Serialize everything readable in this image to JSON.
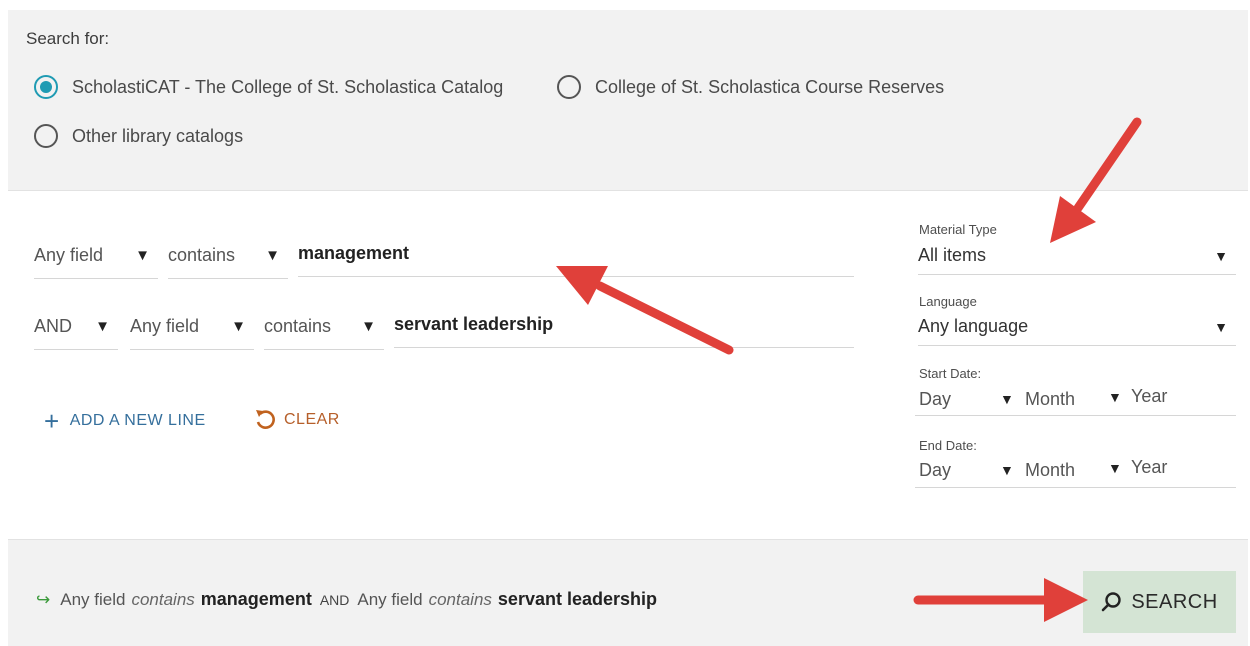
{
  "scope": {
    "title": "Search for:",
    "options": [
      {
        "label": "ScholastiCAT - The College of St. Scholastica Catalog",
        "selected": true
      },
      {
        "label": "College of St. Scholastica Course Reserves",
        "selected": false
      },
      {
        "label": "Other library catalogs",
        "selected": false
      }
    ]
  },
  "query": {
    "rows": [
      {
        "field": "Any field",
        "operator": "contains",
        "value": "management"
      },
      {
        "boolean": "AND",
        "field": "Any field",
        "operator": "contains",
        "value": "servant leadership"
      }
    ],
    "add_line_label": "ADD A NEW LINE",
    "clear_label": "CLEAR"
  },
  "facets": {
    "material_type": {
      "label": "Material Type",
      "value": "All items"
    },
    "language": {
      "label": "Language",
      "value": "Any language"
    },
    "start_date": {
      "label": "Start Date:",
      "day": "Day",
      "month": "Month",
      "year": "Year"
    },
    "end_date": {
      "label": "End Date:",
      "day": "Day",
      "month": "Month",
      "year": "Year"
    }
  },
  "summary": {
    "field1": "Any field",
    "op1": "contains",
    "value1": "management",
    "boolean": "AND",
    "field2": "Any field",
    "op2": "contains",
    "value2": "servant leadership"
  },
  "search_button": {
    "label": "SEARCH"
  },
  "colors": {
    "accent": "#1f9bb3",
    "add_link": "#356f9c",
    "clear_link": "#b65f2a",
    "search_bg": "#d4e4d4",
    "annotation_arrow": "#e0403a"
  },
  "icons": {
    "radio_selected": "radio-checked-icon",
    "radio": "radio-icon",
    "plus": "plus-icon",
    "clear": "undo-icon",
    "search": "magnifier-icon",
    "summary_arrow": "arrow-right-icon",
    "caret": "caret-down-icon"
  }
}
